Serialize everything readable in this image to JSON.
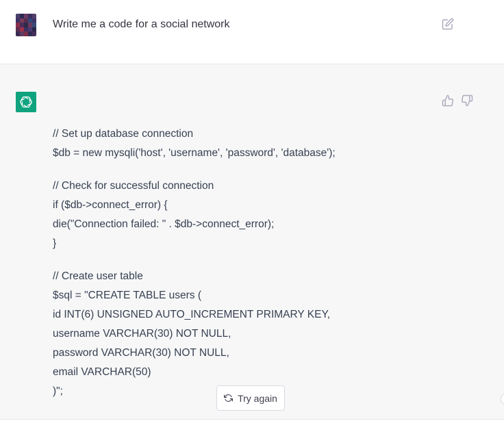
{
  "user_message": {
    "text": "Write me a code for a social network",
    "avatar_icon": "pixelated-user-avatar-icon",
    "edit_icon": "edit-icon"
  },
  "assistant_message": {
    "avatar_icon": "openai-logo-icon",
    "avatar_color": "#10a37f",
    "feedback_icons": [
      "thumbs-up-icon",
      "thumbs-down-icon"
    ],
    "code_paragraphs": [
      [
        "// Set up database connection",
        "$db = new mysqli('host', 'username', 'password', 'database');"
      ],
      [
        "// Check for successful connection",
        "if ($db->connect_error) {",
        "die(\"Connection failed: \" . $db->connect_error);",
        "}"
      ],
      [
        "// Create user table",
        "$sql = \"CREATE TABLE users (",
        "id INT(6) UNSIGNED AUTO_INCREMENT PRIMARY KEY,",
        "username VARCHAR(30) NOT NULL,",
        "password VARCHAR(30) NOT NULL,",
        "email VARCHAR(50)",
        ")\";"
      ]
    ]
  },
  "actions": {
    "try_again_label": "Try again",
    "try_again_icon": "refresh-icon"
  },
  "colors": {
    "assistant_bg": "#f7f7f8",
    "text": "#374151",
    "border": "#e5e7eb"
  }
}
